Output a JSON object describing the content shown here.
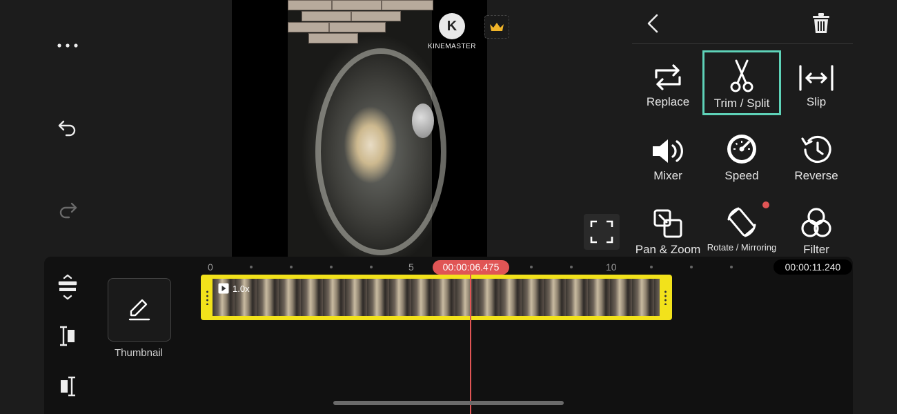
{
  "left_rail": {
    "more_icon": "more-horizontal-icon",
    "undo_icon": "undo-icon",
    "redo_icon": "redo-icon"
  },
  "preview": {
    "watermark_text": "KINEMASTER",
    "logo_letter": "K",
    "premium_icon": "crown-icon",
    "fullscreen_icon": "fullscreen-icon"
  },
  "panel": {
    "back_icon": "chevron-left-icon",
    "delete_icon": "trash-icon",
    "tools": [
      {
        "label": "Replace",
        "icon": "replace-icon"
      },
      {
        "label": "Trim / Split",
        "icon": "scissors-icon",
        "selected": true
      },
      {
        "label": "Slip",
        "icon": "slip-icon"
      },
      {
        "label": "Mixer",
        "icon": "volume-icon"
      },
      {
        "label": "Speed",
        "icon": "speedometer-icon"
      },
      {
        "label": "Reverse",
        "icon": "reverse-icon"
      },
      {
        "label": "Pan & Zoom",
        "icon": "pan-zoom-icon"
      },
      {
        "label": "Rotate / Mirroring",
        "icon": "rotate-icon",
        "badge": true
      },
      {
        "label": "Filter",
        "icon": "filter-icon"
      }
    ]
  },
  "timeline": {
    "ruler_labels": [
      "0",
      "5",
      "10"
    ],
    "playhead_time": "00:00:06.475",
    "total_time": "00:00:11.240",
    "clip_speed": "1.0x",
    "thumbnail_label": "Thumbnail",
    "accent_color": "#f2e21b",
    "playhead_color": "#e05555",
    "selection_color": "#5ed2b8"
  }
}
